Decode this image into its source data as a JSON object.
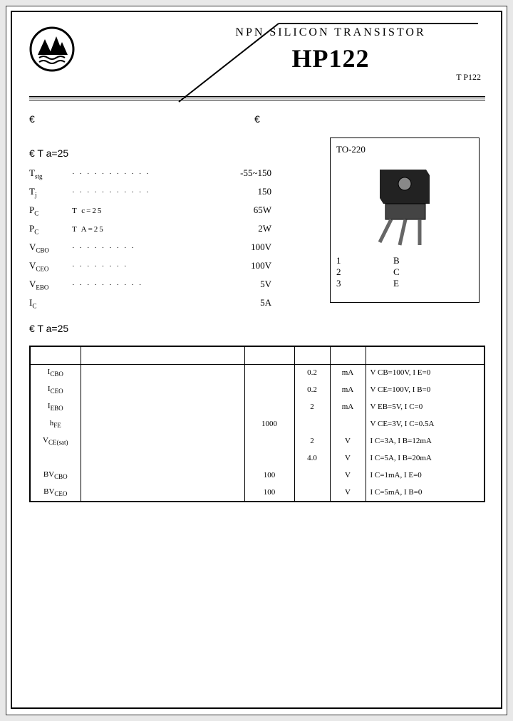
{
  "header": {
    "subtitle": "NPN  SILICON  TRANSISTOR",
    "part": "HP122",
    "alt": "T P122"
  },
  "sections": {
    "s1a": "€",
    "s1b": "€",
    "s2": "€          T a=25",
    "s3": "€          T a=25"
  },
  "package": {
    "type": "TO-220",
    "pins": [
      {
        "n": "1",
        "g": "",
        "l": "B"
      },
      {
        "n": "2",
        "g": "",
        "l": "C"
      },
      {
        "n": "3",
        "g": "",
        "l": "E"
      }
    ]
  },
  "ratings": [
    {
      "sym": "T",
      "sub": "stg",
      "mid": "· · · · · · · · · · ·",
      "val": "-55~150"
    },
    {
      "sym": "T",
      "sub": "j",
      "mid": "· · · · · · · · · · ·",
      "val": "150"
    },
    {
      "sym": "P",
      "sub": "C",
      "mid": "   T c=25    ",
      "val": "65W"
    },
    {
      "sym": "P",
      "sub": "C",
      "mid": "        T A=25",
      "val": "2W"
    },
    {
      "sym": "V",
      "sub": "CBO",
      "mid": "· · · · · · · · ·",
      "val": "100V"
    },
    {
      "sym": "V",
      "sub": "CEO",
      "mid": "· · · · · · · ·",
      "val": "100V"
    },
    {
      "sym": "V",
      "sub": "EBO",
      "mid": "· · · · · · · · · ·",
      "val": "5V"
    },
    {
      "sym": "I",
      "sub": "C",
      "mid": "",
      "val": "5A"
    }
  ],
  "char_header": [
    "",
    "",
    "",
    "",
    "",
    ""
  ],
  "char_rows": [
    {
      "sym": "I",
      "sub": "CBO",
      "p": "",
      "min": "",
      "max": "0.2",
      "u": "mA",
      "cond": "V CB=100V,  I E=0"
    },
    {
      "sym": "I",
      "sub": "CEO",
      "p": "",
      "min": "",
      "max": "0.2",
      "u": "mA",
      "cond": "V CE=100V,  I B=0"
    },
    {
      "sym": "I",
      "sub": "EBO",
      "p": "",
      "min": "",
      "max": "2",
      "u": "mA",
      "cond": "V EB=5V,  I C=0"
    },
    {
      "sym": "h",
      "sub": "FE",
      "p": "",
      "min": "1000",
      "max": "",
      "u": "",
      "cond": "V CE=3V,  I C=0.5A"
    },
    {
      "sym": "V",
      "sub": "CE(sat)",
      "p": "",
      "min": "",
      "max": "2",
      "u": "V",
      "cond": "I C=3A,  I B=12mA"
    },
    {
      "sym": "",
      "sub": "",
      "p": "",
      "min": "",
      "max": "4.0",
      "u": "V",
      "cond": "I C=5A,  I B=20mA"
    },
    {
      "sym": "BV",
      "sub": "CBO",
      "p": "",
      "min": "100",
      "max": "",
      "u": "V",
      "cond": "I C=1mA,  I E=0"
    },
    {
      "sym": "BV",
      "sub": "CEO",
      "p": "",
      "min": "100",
      "max": "",
      "u": "V",
      "cond": "I C=5mA,  I B=0"
    }
  ]
}
